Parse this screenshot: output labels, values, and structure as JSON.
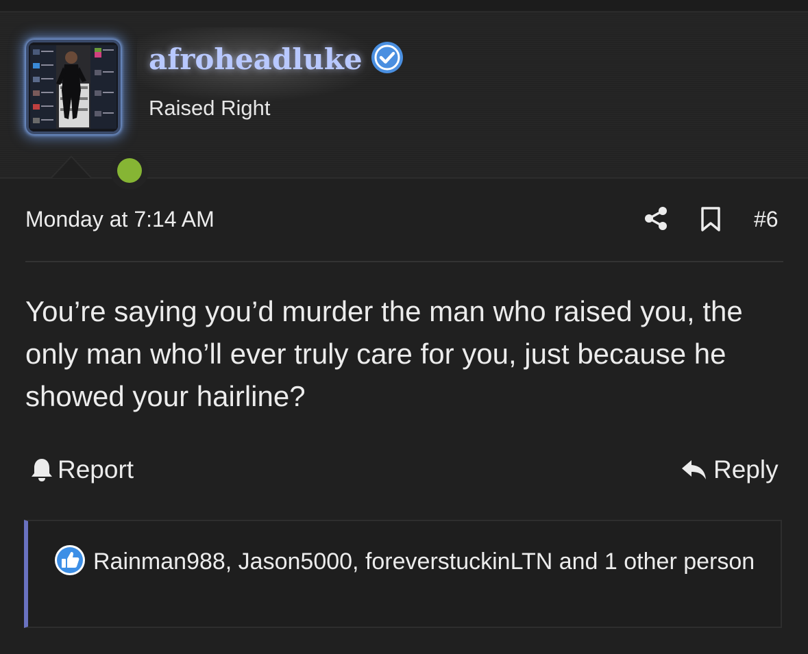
{
  "user": {
    "username": "afroheadluke",
    "title": "Raised Right",
    "verified": true,
    "online": true,
    "username_color": "#b8c8ff",
    "online_color": "#86b534"
  },
  "post": {
    "timestamp": "Monday at 7:14 AM",
    "number": "#6",
    "message": "You’re saying you’d murder the man who raised you, the only man who’ll ever truly care for you, just because he showed your hairline?"
  },
  "actions": {
    "report_label": "Report",
    "reply_label": "Reply"
  },
  "reactions": {
    "text": "Rainman988, Jason5000, foreverstuckinLTN and 1 other person",
    "icon": "thumbs-up-icon"
  },
  "icons": {
    "share": "share-icon",
    "bookmark": "bookmark-icon",
    "report": "bell-icon",
    "reply": "reply-arrow-icon",
    "verified": "verified-check-icon"
  }
}
